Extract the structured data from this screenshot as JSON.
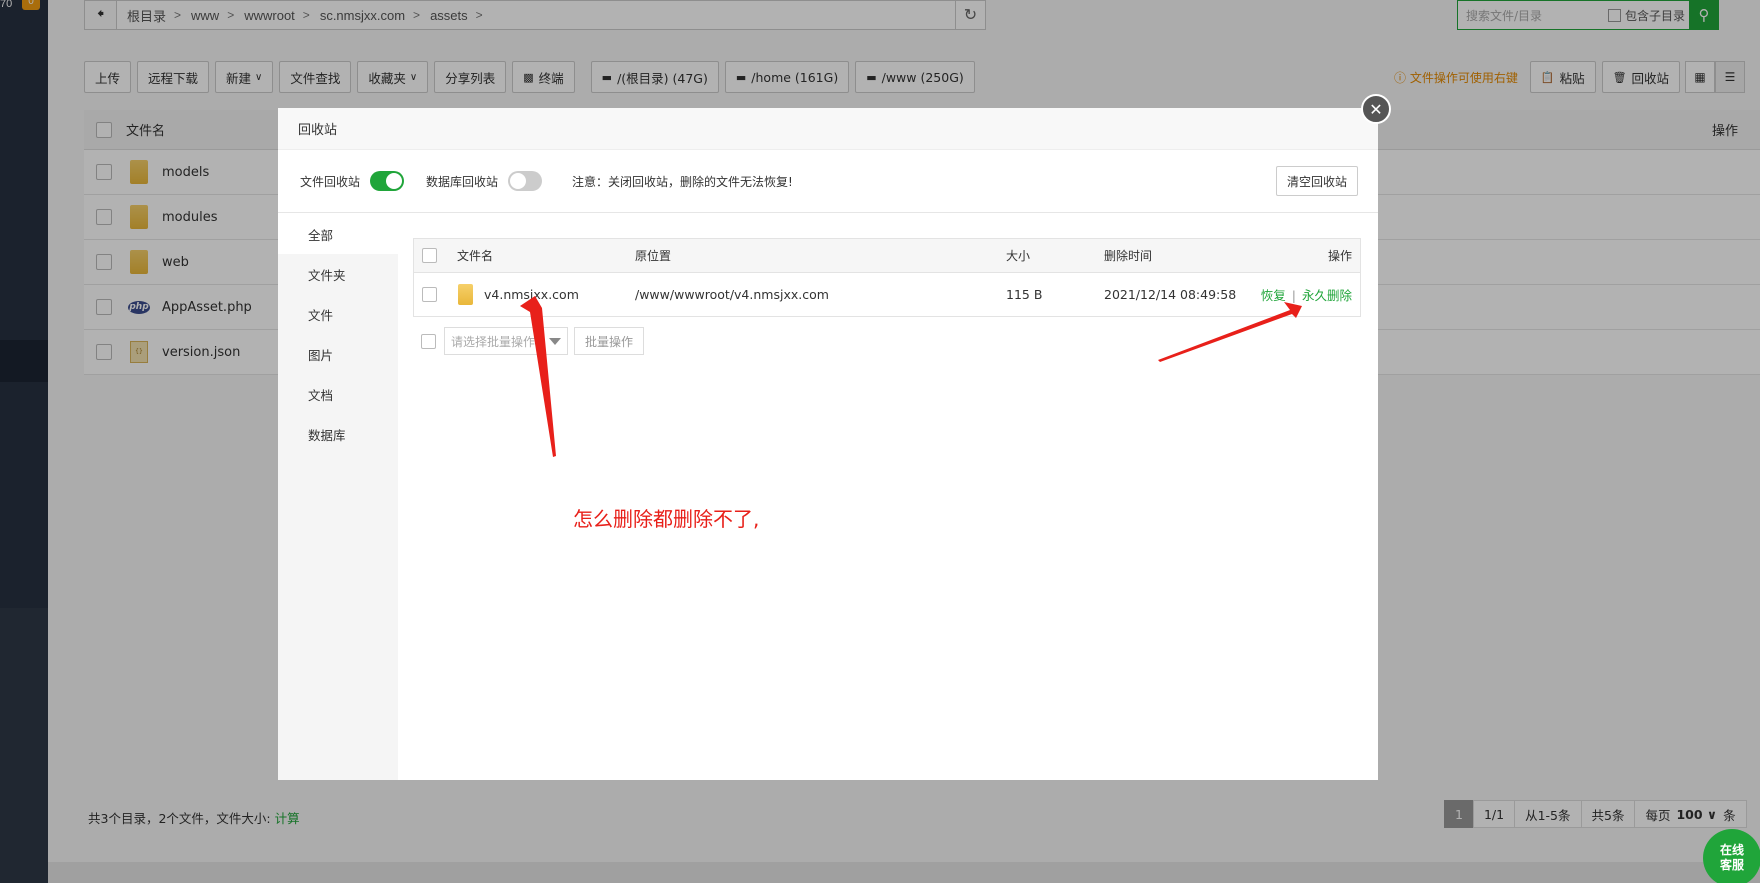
{
  "sidebar": {
    "badge_num": "70",
    "badge": "0"
  },
  "path": {
    "crumbs": [
      "根目录",
      "www",
      "wwwroot",
      "sc.nmsjxx.com",
      "assets"
    ]
  },
  "search": {
    "placeholder": "搜索文件/目录",
    "subdir_label": "包含子目录"
  },
  "toolbar": {
    "upload": "上传",
    "remote": "远程下载",
    "new": "新建",
    "find": "文件查找",
    "fav": "收藏夹",
    "share": "分享列表",
    "terminal": "终端",
    "disk_root": "/(根目录) (47G)",
    "disk_home": "/home (161G)",
    "disk_www": "/www (250G)"
  },
  "toolbar_right": {
    "hint": "文件操作可使用右键",
    "paste": "粘贴",
    "recycle": "回收站"
  },
  "filetable": {
    "col_name": "文件名",
    "col_op": "操作",
    "rows": [
      {
        "name": "models",
        "type": "folder"
      },
      {
        "name": "modules",
        "type": "folder"
      },
      {
        "name": "web",
        "type": "folder"
      },
      {
        "name": "AppAsset.php",
        "type": "php"
      },
      {
        "name": "version.json",
        "type": "json"
      }
    ]
  },
  "footer": {
    "info": "共3个目录，2个文件，文件大小:",
    "calc": "计算"
  },
  "pager": {
    "cur": "1",
    "pages": "1/1",
    "range": "从1-5条",
    "total": "共5条",
    "per_label": "每页",
    "per_value": "100",
    "unit": "条"
  },
  "service": {
    "line1": "在线",
    "line2": "客服"
  },
  "modal": {
    "title": "回收站",
    "file_recycle": "文件回收站",
    "db_recycle": "数据库回收站",
    "note": "注意：关闭回收站，删除的文件无法恢复!",
    "clear": "清空回收站",
    "tabs": [
      "全部",
      "文件夹",
      "文件",
      "图片",
      "文档",
      "数据库"
    ],
    "headers": {
      "name": "文件名",
      "origin": "原位置",
      "size": "大小",
      "time": "删除时间",
      "op": "操作"
    },
    "row": {
      "name": "v4.nmsjxx.com",
      "origin": "/www/wwwroot/v4.nmsjxx.com",
      "size": "115 B",
      "time": "2021/12/14 08:49:58",
      "restore": "恢复",
      "delete": "永久删除"
    },
    "batch_placeholder": "请选择批量操作",
    "batch_btn": "批量操作"
  },
  "annotation": {
    "text": "怎么删除都删除不了,",
    "color": "#e8201a"
  }
}
